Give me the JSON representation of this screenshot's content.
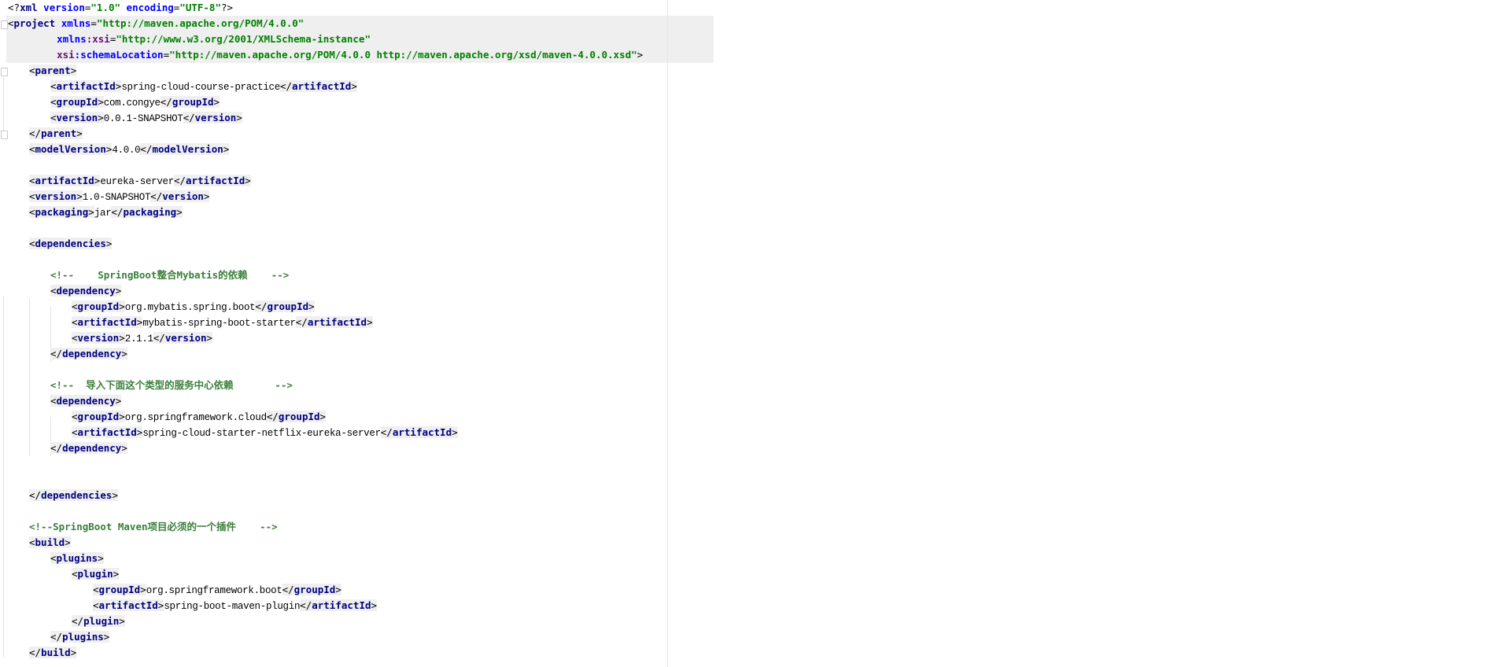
{
  "editor": {
    "lines": [
      {
        "i": 0,
        "tokens": [
          [
            "b",
            "<?"
          ],
          [
            "t",
            "xml "
          ],
          [
            "an",
            "version"
          ],
          [
            "b",
            "="
          ],
          [
            "av",
            "\"1.0\" "
          ],
          [
            "an",
            "encoding"
          ],
          [
            "b",
            "="
          ],
          [
            "av",
            "\"UTF-8\""
          ],
          [
            "b",
            "?>"
          ]
        ]
      },
      {
        "i": 0,
        "tokens": [
          [
            "b",
            "<"
          ],
          [
            "t",
            "project "
          ],
          [
            "an",
            "xmlns"
          ],
          [
            "b",
            "="
          ],
          [
            "av",
            "\"http://maven.apache.org/POM/4.0.0\""
          ]
        ]
      },
      {
        "i": 2.3,
        "tokens": [
          [
            "an",
            "xmlns"
          ],
          [
            "ap",
            ":xsi"
          ],
          [
            "b",
            "="
          ],
          [
            "av",
            "\"http://www.w3.org/2001/XMLSchema-instance\""
          ]
        ]
      },
      {
        "i": 2.3,
        "tokens": [
          [
            "ap",
            "xsi"
          ],
          [
            "an",
            ":schemaLocation"
          ],
          [
            "b",
            "="
          ],
          [
            "av",
            "\"http://maven.apache.org/POM/4.0.0 http://maven.apache.org/xsd/maven-4.0.0.xsd\""
          ],
          [
            "b",
            ">"
          ]
        ]
      },
      {
        "i": 1,
        "tokens": [
          [
            "b",
            "<"
          ],
          [
            "t",
            "parent"
          ],
          [
            "b",
            ">"
          ]
        ]
      },
      {
        "i": 2,
        "tokens": [
          [
            "b",
            "<"
          ],
          [
            "t",
            "artifactId"
          ],
          [
            "b",
            ">"
          ],
          [
            "x",
            "spring-cloud-course-practice"
          ],
          [
            "b",
            "</"
          ],
          [
            "t",
            "artifactId"
          ],
          [
            "b",
            ">"
          ]
        ]
      },
      {
        "i": 2,
        "tokens": [
          [
            "b",
            "<"
          ],
          [
            "t",
            "groupId"
          ],
          [
            "b",
            ">"
          ],
          [
            "x",
            "com.congye"
          ],
          [
            "b",
            "</"
          ],
          [
            "t",
            "groupId"
          ],
          [
            "b",
            ">"
          ]
        ]
      },
      {
        "i": 2,
        "tokens": [
          [
            "b",
            "<"
          ],
          [
            "t",
            "version"
          ],
          [
            "b",
            ">"
          ],
          [
            "x",
            "0.0.1-SNAPSHOT"
          ],
          [
            "b",
            "</"
          ],
          [
            "t",
            "version"
          ],
          [
            "b",
            ">"
          ]
        ]
      },
      {
        "i": 1,
        "tokens": [
          [
            "b",
            "</"
          ],
          [
            "t",
            "parent"
          ],
          [
            "b",
            ">"
          ]
        ]
      },
      {
        "i": 1,
        "tokens": [
          [
            "b",
            "<"
          ],
          [
            "t",
            "modelVersion"
          ],
          [
            "b",
            ">"
          ],
          [
            "x",
            "4.0.0"
          ],
          [
            "b",
            "</"
          ],
          [
            "t",
            "modelVersion"
          ],
          [
            "b",
            ">"
          ]
        ]
      },
      {
        "i": 0,
        "tokens": []
      },
      {
        "i": 1,
        "tokens": [
          [
            "b",
            "<"
          ],
          [
            "t",
            "artifactId"
          ],
          [
            "b",
            ">"
          ],
          [
            "x",
            "eureka-server"
          ],
          [
            "b",
            "</"
          ],
          [
            "t",
            "artifactId"
          ],
          [
            "b",
            ">"
          ]
        ]
      },
      {
        "i": 1,
        "tokens": [
          [
            "b",
            "<"
          ],
          [
            "t",
            "version"
          ],
          [
            "b",
            ">"
          ],
          [
            "x",
            "1.0-SNAPSHOT"
          ],
          [
            "b",
            "</"
          ],
          [
            "t",
            "version"
          ],
          [
            "b",
            ">"
          ]
        ]
      },
      {
        "i": 1,
        "tokens": [
          [
            "b",
            "<"
          ],
          [
            "t",
            "packaging"
          ],
          [
            "b",
            ">"
          ],
          [
            "x",
            "jar"
          ],
          [
            "b",
            "</"
          ],
          [
            "t",
            "packaging"
          ],
          [
            "b",
            ">"
          ]
        ]
      },
      {
        "i": 0,
        "tokens": []
      },
      {
        "i": 1,
        "tokens": [
          [
            "b",
            "<"
          ],
          [
            "t",
            "dependencies"
          ],
          [
            "b",
            ">"
          ]
        ]
      },
      {
        "i": 0,
        "tokens": []
      },
      {
        "i": 2,
        "tokens": [
          [
            "c",
            "<!--    SpringBoot整合Mybatis的依赖    -->"
          ]
        ]
      },
      {
        "i": 2,
        "tokens": [
          [
            "b",
            "<"
          ],
          [
            "t",
            "dependency"
          ],
          [
            "b",
            ">"
          ]
        ]
      },
      {
        "i": 3,
        "tokens": [
          [
            "b",
            "<"
          ],
          [
            "t",
            "groupId"
          ],
          [
            "b",
            ">"
          ],
          [
            "x",
            "org.mybatis.spring.boot"
          ],
          [
            "b",
            "</"
          ],
          [
            "t",
            "groupId"
          ],
          [
            "b",
            ">"
          ]
        ]
      },
      {
        "i": 3,
        "tokens": [
          [
            "b",
            "<"
          ],
          [
            "t",
            "artifactId"
          ],
          [
            "b",
            ">"
          ],
          [
            "x",
            "mybatis-spring-boot-starter"
          ],
          [
            "b",
            "</"
          ],
          [
            "t",
            "artifactId"
          ],
          [
            "b",
            ">"
          ]
        ]
      },
      {
        "i": 3,
        "tokens": [
          [
            "b",
            "<"
          ],
          [
            "t",
            "version"
          ],
          [
            "b",
            ">"
          ],
          [
            "x",
            "2.1.1"
          ],
          [
            "b",
            "</"
          ],
          [
            "t",
            "version"
          ],
          [
            "b",
            ">"
          ]
        ]
      },
      {
        "i": 2,
        "tokens": [
          [
            "b",
            "</"
          ],
          [
            "t",
            "dependency"
          ],
          [
            "b",
            ">"
          ]
        ]
      },
      {
        "i": 0,
        "tokens": []
      },
      {
        "i": 2,
        "tokens": [
          [
            "c",
            "<!--  导入下面这个类型的服务中心依赖       -->"
          ]
        ]
      },
      {
        "i": 2,
        "tokens": [
          [
            "b",
            "<"
          ],
          [
            "t",
            "dependency"
          ],
          [
            "b",
            ">"
          ]
        ]
      },
      {
        "i": 3,
        "tokens": [
          [
            "b",
            "<"
          ],
          [
            "t",
            "groupId"
          ],
          [
            "b",
            ">"
          ],
          [
            "x",
            "org.springframework.cloud"
          ],
          [
            "b",
            "</"
          ],
          [
            "t",
            "groupId"
          ],
          [
            "b",
            ">"
          ]
        ]
      },
      {
        "i": 3,
        "tokens": [
          [
            "b",
            "<"
          ],
          [
            "t",
            "artifactId"
          ],
          [
            "b",
            ">"
          ],
          [
            "x",
            "spring-cloud-starter-netflix-eureka-server"
          ],
          [
            "b",
            "</"
          ],
          [
            "t",
            "artifactId"
          ],
          [
            "b",
            ">"
          ]
        ]
      },
      {
        "i": 2,
        "tokens": [
          [
            "b",
            "</"
          ],
          [
            "t",
            "dependency"
          ],
          [
            "b",
            ">"
          ]
        ]
      },
      {
        "i": 0,
        "tokens": []
      },
      {
        "i": 0,
        "tokens": []
      },
      {
        "i": 1,
        "tokens": [
          [
            "b",
            "</"
          ],
          [
            "t",
            "dependencies"
          ],
          [
            "b",
            ">"
          ]
        ]
      },
      {
        "i": 0,
        "tokens": []
      },
      {
        "i": 1,
        "tokens": [
          [
            "c",
            "<!--SpringBoot Maven项目必须的一个插件    -->"
          ]
        ]
      },
      {
        "i": 1,
        "tokens": [
          [
            "b",
            "<"
          ],
          [
            "t",
            "build"
          ],
          [
            "b",
            ">"
          ]
        ]
      },
      {
        "i": 2,
        "tokens": [
          [
            "b",
            "<"
          ],
          [
            "t",
            "plugins"
          ],
          [
            "b",
            ">"
          ]
        ]
      },
      {
        "i": 3,
        "tokens": [
          [
            "b",
            "<"
          ],
          [
            "t",
            "plugin"
          ],
          [
            "b",
            ">"
          ]
        ]
      },
      {
        "i": 4,
        "tokens": [
          [
            "b",
            "<"
          ],
          [
            "t",
            "groupId"
          ],
          [
            "b",
            ">"
          ],
          [
            "x",
            "org.springframework.boot"
          ],
          [
            "b",
            "</"
          ],
          [
            "t",
            "groupId"
          ],
          [
            "b",
            ">"
          ]
        ]
      },
      {
        "i": 4,
        "tokens": [
          [
            "b",
            "<"
          ],
          [
            "t",
            "artifactId"
          ],
          [
            "b",
            ">"
          ],
          [
            "x",
            "spring-boot-maven-plugin"
          ],
          [
            "b",
            "</"
          ],
          [
            "t",
            "artifactId"
          ],
          [
            "b",
            ">"
          ]
        ]
      },
      {
        "i": 3,
        "tokens": [
          [
            "b",
            "</"
          ],
          [
            "t",
            "plugin"
          ],
          [
            "b",
            ">"
          ]
        ]
      },
      {
        "i": 2,
        "tokens": [
          [
            "b",
            "</"
          ],
          [
            "t",
            "plugins"
          ],
          [
            "b",
            ">"
          ]
        ]
      },
      {
        "i": 1,
        "tokens": [
          [
            "b",
            "</"
          ],
          [
            "t",
            "build"
          ],
          [
            "b",
            ">"
          ]
        ]
      }
    ]
  }
}
